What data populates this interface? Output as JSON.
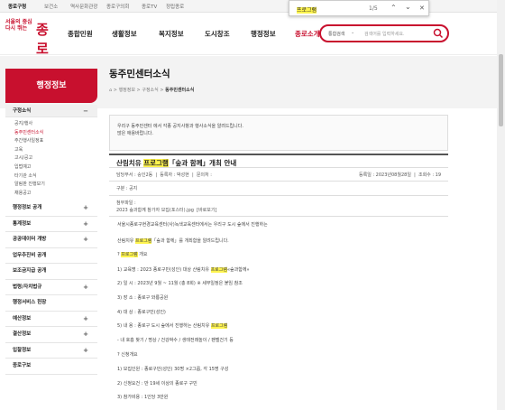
{
  "topbar": {
    "items": [
      "종로구청",
      "보건소",
      "역사문화관광",
      "종로구의회",
      "종로TV",
      "정립종로"
    ]
  },
  "findbar": {
    "query": "프로그램",
    "count": "1/5",
    "up": "⌃",
    "down": "⌄",
    "close": "✕"
  },
  "logo": {
    "line1": "서울의 중심",
    "line2": "다시 뛰는",
    "name": "종로"
  },
  "gnb": [
    "종합민원",
    "생활정보",
    "복지정보",
    "도시창조",
    "행정정보",
    "종로소개"
  ],
  "search": {
    "scope": "통합검색",
    "placeholder": "검색어를 입력하세요."
  },
  "lnb": {
    "title": "행정정보",
    "open_section": "구정소식",
    "open_sign": "−",
    "sub_items": [
      "공지/행사",
      "동주민센터소식",
      "주간행사일정표",
      "고육",
      "고시/공고",
      "입법예고",
      "타기관 소식",
      "알림판 진행보기",
      "채용공고"
    ],
    "active_index": 1,
    "sections": [
      "행정정보 공개",
      "통계정보",
      "공공데이터 개방",
      "업무추진비 공개",
      "보조금지급 공개",
      "법령/자치법규",
      "행정서비스 헌장",
      "예산정보",
      "결산정보",
      "입찰정보",
      "종로구보"
    ],
    "plus": "+"
  },
  "page": {
    "title": "동주민센터소식",
    "breadcrumb": [
      "⌂",
      "행정정보",
      "구정소식",
      "동주민센터소식"
    ]
  },
  "intro": {
    "line1": "우리구 동주민센터 에서 각종 공지사항과 행사소식을 알려드립니다.",
    "line2": "많은 애용바랍니다."
  },
  "post": {
    "title_pre": "산림치유 ",
    "title_hl": "프로그램",
    "title_post": "「숲과 함께」개최 안내",
    "author_label": "담당부서 : 숭인2동",
    "writer_label": "등록자 : 박성현",
    "contact_label": "문의처 :",
    "date_label": "등록일 : 2023년08월28일",
    "views_label": "조회수 : 19",
    "category": "구분 : 공지",
    "attach_label": "첨부파일 :",
    "attach_file": "2023 숲과함께 참가자 모집(포스터).jpg",
    "attach_view": "[바로보기]"
  },
  "body": {
    "l1": "서울시종로구현경교육센터(사)녹색교육센터에서는 우리구 도시 숲에서 진행하는",
    "l2_pre": "산림치유 ",
    "l2_hl": "프로그램",
    "l2_post": "「숲과 함께」를 개최함을 알려드립니다.",
    "l3_pre": "? ",
    "l3_hl": "프로그램",
    "l3_post": " 개요",
    "l4_pre": "1) 교육명 : 2023 종로구민(성인) 대상 산림치유 ",
    "l4_hl": "프로그램",
    "l4_post": "«숲과함께»",
    "l5": "2) 일 시 : 2023년 9월 ~ 11월 (총 8회) ※ 세부일정은 붙임 참조",
    "l6": "3) 장 소 : 종로구 와룡공원",
    "l7": "4) 대 상 : 종로구민(성인)",
    "l8_pre": "5) 내 용 : 종로구 도시 숲에서 진행하는 산림치유 ",
    "l8_hl": "프로그램",
    "l9": "- 내 호흡 찾기 / 명상 / 건강박수 / 생태전래놀이 / 팬벨건기 등",
    "l10": "? 신청개요",
    "l11": "1) 모집인원 : 종로구민(성인) 30명 ×2그룹, 각 15명 구성",
    "l12": "2) 신청요건 : 만 19세 이상의 종로구 구민",
    "l13": "3) 참가비용 : 1인당 3만원"
  }
}
